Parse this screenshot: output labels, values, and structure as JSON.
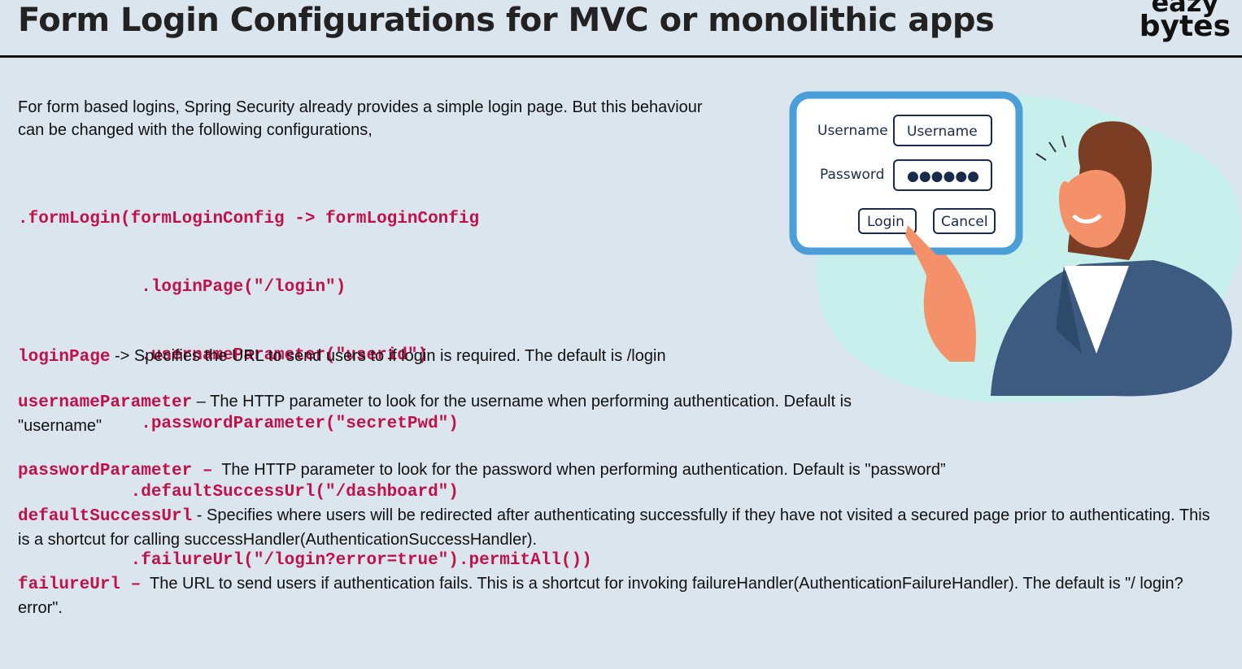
{
  "header": {
    "title": "Form Login Configurations for MVC or monolithic apps",
    "logo_line1": "eazy",
    "logo_line2": "bytes"
  },
  "intro": {
    "text": "For form based logins, Spring Security already provides a simple login page. But this behaviour can be changed with the following configurations,"
  },
  "code": {
    "lines": [
      ".formLogin(formLoginConfig -> formLoginConfig",
      "            .loginPage(\"/login\")",
      "            .usernameParameter(\"userid\")",
      "            .passwordParameter(\"secretPwd\")",
      "           .defaultSuccessUrl(\"/dashboard\")",
      "           .failureUrl(\"/login?error=true\").permitAll())"
    ]
  },
  "definitions": [
    {
      "term": "loginPage",
      "separator": " -> ",
      "text": "Specifies the URL to send users to if login is required. The default is /login"
    },
    {
      "term": "usernameParameter",
      "separator": " – ",
      "text": "The HTTP parameter to look for the username when performing authentication. Default is \"username\""
    },
    {
      "term": "passwordParameter –",
      "separator": "  ",
      "text": "The HTTP parameter to look for the password when performing authentication. Default is \"password”"
    },
    {
      "term": "defaultSuccessUrl",
      "separator": " - ",
      "text": "Specifies where users will be redirected after authenticating successfully if they have not visited a secured page prior to authenticating. This is a shortcut for calling successHandler(AuthenticationSuccessHandler)."
    },
    {
      "term": "failureUrl –",
      "separator": "  ",
      "text": "The URL to send users if authentication fails. This is a shortcut for invoking failureHandler(AuthenticationFailureHandler). The default is \"/ login?error\"."
    }
  ],
  "illustration": {
    "username_label": "Username",
    "username_value": "Username",
    "password_label": "Password",
    "password_value": "●●●●●●",
    "login_button": "Login",
    "cancel_button": "Cancel",
    "icon": "person-pointing-at-login-form"
  },
  "colors": {
    "background": "#dbe5ee",
    "code": "#c0114a",
    "form_frame": "#4a9fd8",
    "blob": "#c7f0ec"
  }
}
